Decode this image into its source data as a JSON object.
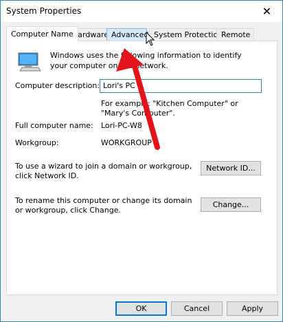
{
  "window": {
    "title": "System Properties",
    "close_glyph": "✕"
  },
  "tabs": [
    {
      "label": "Computer Name"
    },
    {
      "label": "Hardware"
    },
    {
      "label": "Advanced"
    },
    {
      "label": "System Protection"
    },
    {
      "label": "Remote"
    }
  ],
  "panel": {
    "intro": "Windows uses the following information to identify your computer on the network.",
    "description_label": "Computer description:",
    "description_value": "Lori's PC",
    "example": "For example: \"Kitchen Computer\" or \"Mary's Computer\".",
    "full_name_label": "Full computer name:",
    "full_name_value": "Lori-PC-W8",
    "workgroup_label": "Workgroup:",
    "workgroup_value": "WORKGROUP",
    "network_text": "To use a wizard to join a domain or workgroup, click Network ID.",
    "network_button": "Network ID...",
    "change_text": "To rename this computer or change its domain or workgroup, click Change.",
    "change_button": "Change..."
  },
  "footer": {
    "ok": "OK",
    "cancel": "Cancel",
    "apply": "Apply"
  },
  "colors": {
    "accent": "#0078d7",
    "arrow": "#e3131b"
  },
  "icons": {
    "computer": "computer-icon",
    "close": "close-icon",
    "cursor": "mouse-pointer-icon",
    "arrow": "red-arrow-annotation"
  }
}
